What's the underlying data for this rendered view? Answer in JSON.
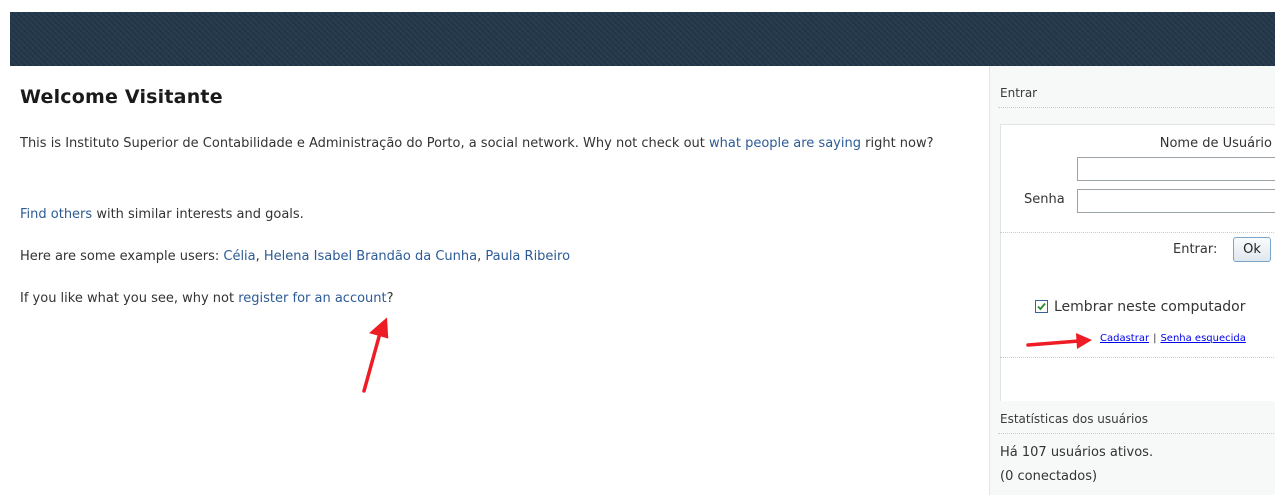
{
  "page": {
    "title": "Welcome Visitante",
    "intro_text_1": "This is Instituto Superior de Contabilidade e Administração do Porto, a social network. Why not check out ",
    "intro_link": "what people are saying",
    "intro_text_2": " right now?",
    "find_link": "Find others",
    "find_text": " with similar interests and goals.",
    "examples_text": "Here are some example users: ",
    "example_users": [
      "Célia",
      "Helena Isabel Brandão da Cunha",
      "Paula Ribeiro"
    ],
    "example_sep": ", ",
    "register_text_1": "If you like what you see, why not ",
    "register_link": "register for an account",
    "register_text_2": "?"
  },
  "login": {
    "heading": "Entrar",
    "username_label": "Nome de Usuário",
    "username_value": "",
    "password_label": "Senha",
    "password_value": "",
    "submit_label": "Entrar:",
    "ok_button": "Ok",
    "remember_label": "Lembrar neste computador",
    "remember_checked": true,
    "register_link": "Cadastrar",
    "link_separator": "|",
    "forgot_link": "Senha esquecida"
  },
  "stats": {
    "heading": "Estatísticas dos usuários",
    "active_users": "Há 107 usuários ativos.",
    "online": "(0 conectados)"
  },
  "colors": {
    "header": "#23374a",
    "link": "#2d5b96",
    "annotation_arrow": "#ee1c24"
  },
  "icons": {
    "annotation": "red-arrow-icon",
    "checkbox": "checkmark-icon"
  }
}
